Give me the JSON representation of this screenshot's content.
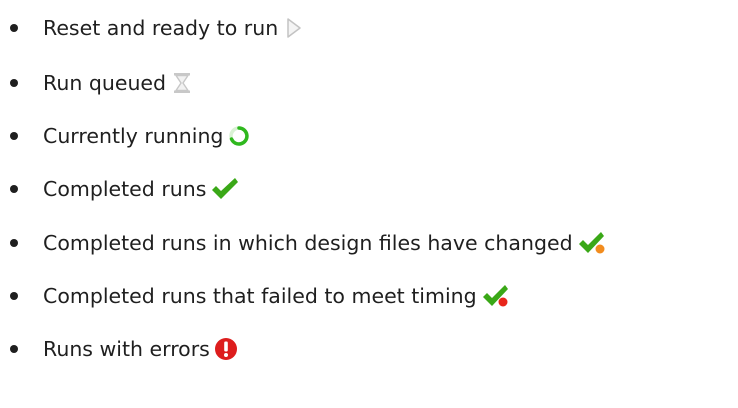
{
  "items": [
    {
      "label": "Reset and ready to run",
      "icon": "play-outline-icon"
    },
    {
      "label": "Run queued",
      "icon": "hourglass-icon"
    },
    {
      "label": "Currently running",
      "icon": "spinner-icon"
    },
    {
      "label": "Completed runs",
      "icon": "checkmark-icon"
    },
    {
      "label": "Completed runs in which design files have changed",
      "icon": "checkmark-orange-dot-icon"
    },
    {
      "label": "Completed runs that failed to meet timing",
      "icon": "checkmark-red-dot-icon"
    },
    {
      "label": "Runs with errors",
      "icon": "error-exclamation-icon"
    }
  ],
  "colors": {
    "text": "#1f1f1f",
    "check_green": "#3aa817",
    "spinner_green": "#2fb81e",
    "orange_dot": "#f28c1e",
    "red_dot": "#e8261b",
    "error_red": "#dd1d1d",
    "grey_icon": "#c8c8c8"
  }
}
